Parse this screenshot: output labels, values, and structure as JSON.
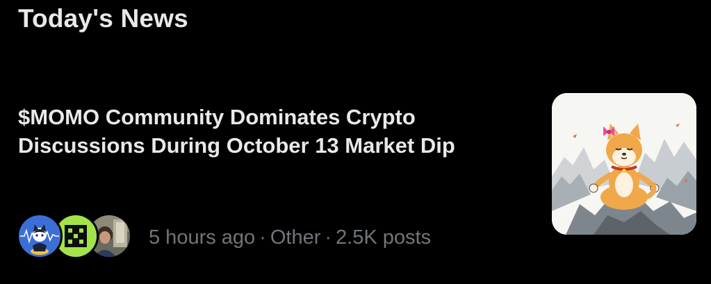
{
  "section": {
    "title": "Today's News"
  },
  "news_item": {
    "headline": "$MOMO Community Dominates Crypto Discussions During October 13 Market Dip",
    "time_ago": "5 hours ago",
    "separator": "·",
    "category": "Other",
    "post_count": "2.5K posts",
    "avatars": [
      "cat-avatar",
      "green-pixel-logo-avatar",
      "person-photo-avatar"
    ],
    "thumbnail": "meditating-dog-mascot-image"
  },
  "colors": {
    "background": "#000000",
    "primary_text": "#e7e9ea",
    "secondary_text": "#71767b",
    "accent_green": "#a3e34a",
    "avatar_blue": "#3b6fd8"
  }
}
